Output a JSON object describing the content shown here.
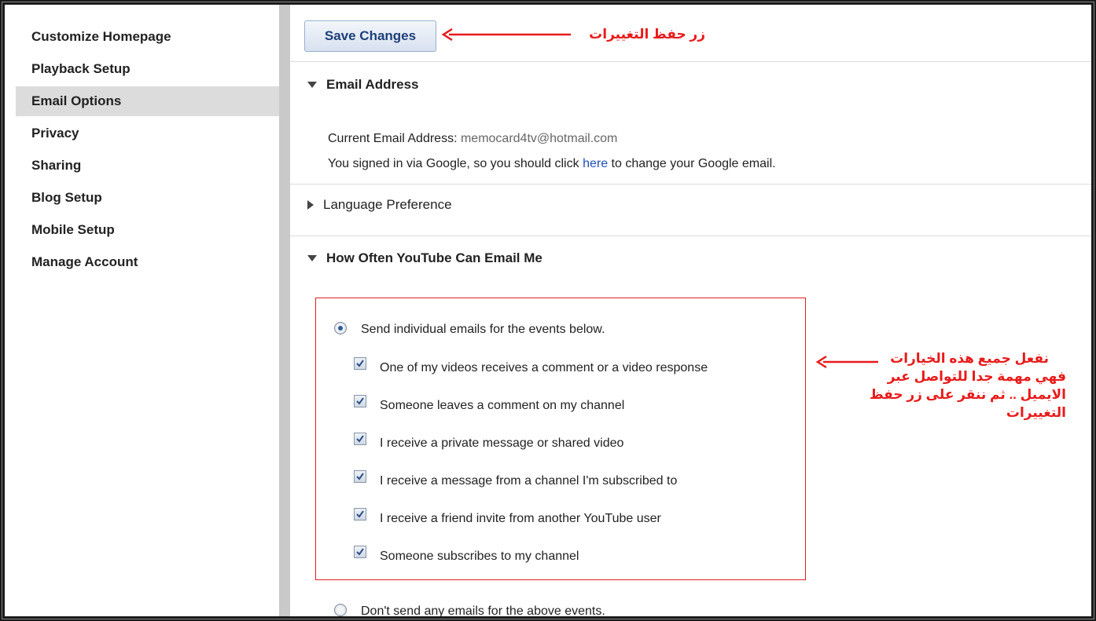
{
  "sidebar": {
    "items": [
      {
        "label": "Customize Homepage"
      },
      {
        "label": "Playback Setup"
      },
      {
        "label": "Email Options",
        "active": true
      },
      {
        "label": "Privacy"
      },
      {
        "label": "Sharing"
      },
      {
        "label": "Blog Setup"
      },
      {
        "label": "Mobile Setup"
      },
      {
        "label": "Manage Account"
      }
    ]
  },
  "toolbar": {
    "save_label": "Save Changes"
  },
  "email_section": {
    "title": "Email Address",
    "current_label": "Current Email Address:",
    "current_value": "memocard4tv@hotmail.com",
    "signin_pre": "You signed in via Google, so you should click",
    "signin_link": "here",
    "signin_post": "to change your Google email."
  },
  "language_section": {
    "title": "Language Preference"
  },
  "frequency_section": {
    "title": "How Often YouTube Can Email Me",
    "option_send": "Send individual emails for the events below.",
    "events": [
      "One of my videos receives a comment or a video response",
      "Someone leaves a comment on my channel",
      "I receive a private message or shared video",
      "I receive a message from a channel I'm subscribed to",
      "I receive a friend invite from another YouTube user",
      "Someone subscribes to my channel"
    ],
    "option_dont": "Don't send any emails for the above events."
  },
  "annotations": {
    "save_note": "زر حفظ التغييرات",
    "options_note": [
      "نفعل جميع هذه الخيارات",
      "فهي مهمة جدا للتواصل عبر",
      "الايميل .. ثم ننقر على زر حفظ",
      "التغييرات"
    ],
    "color": "#e81b1b"
  }
}
